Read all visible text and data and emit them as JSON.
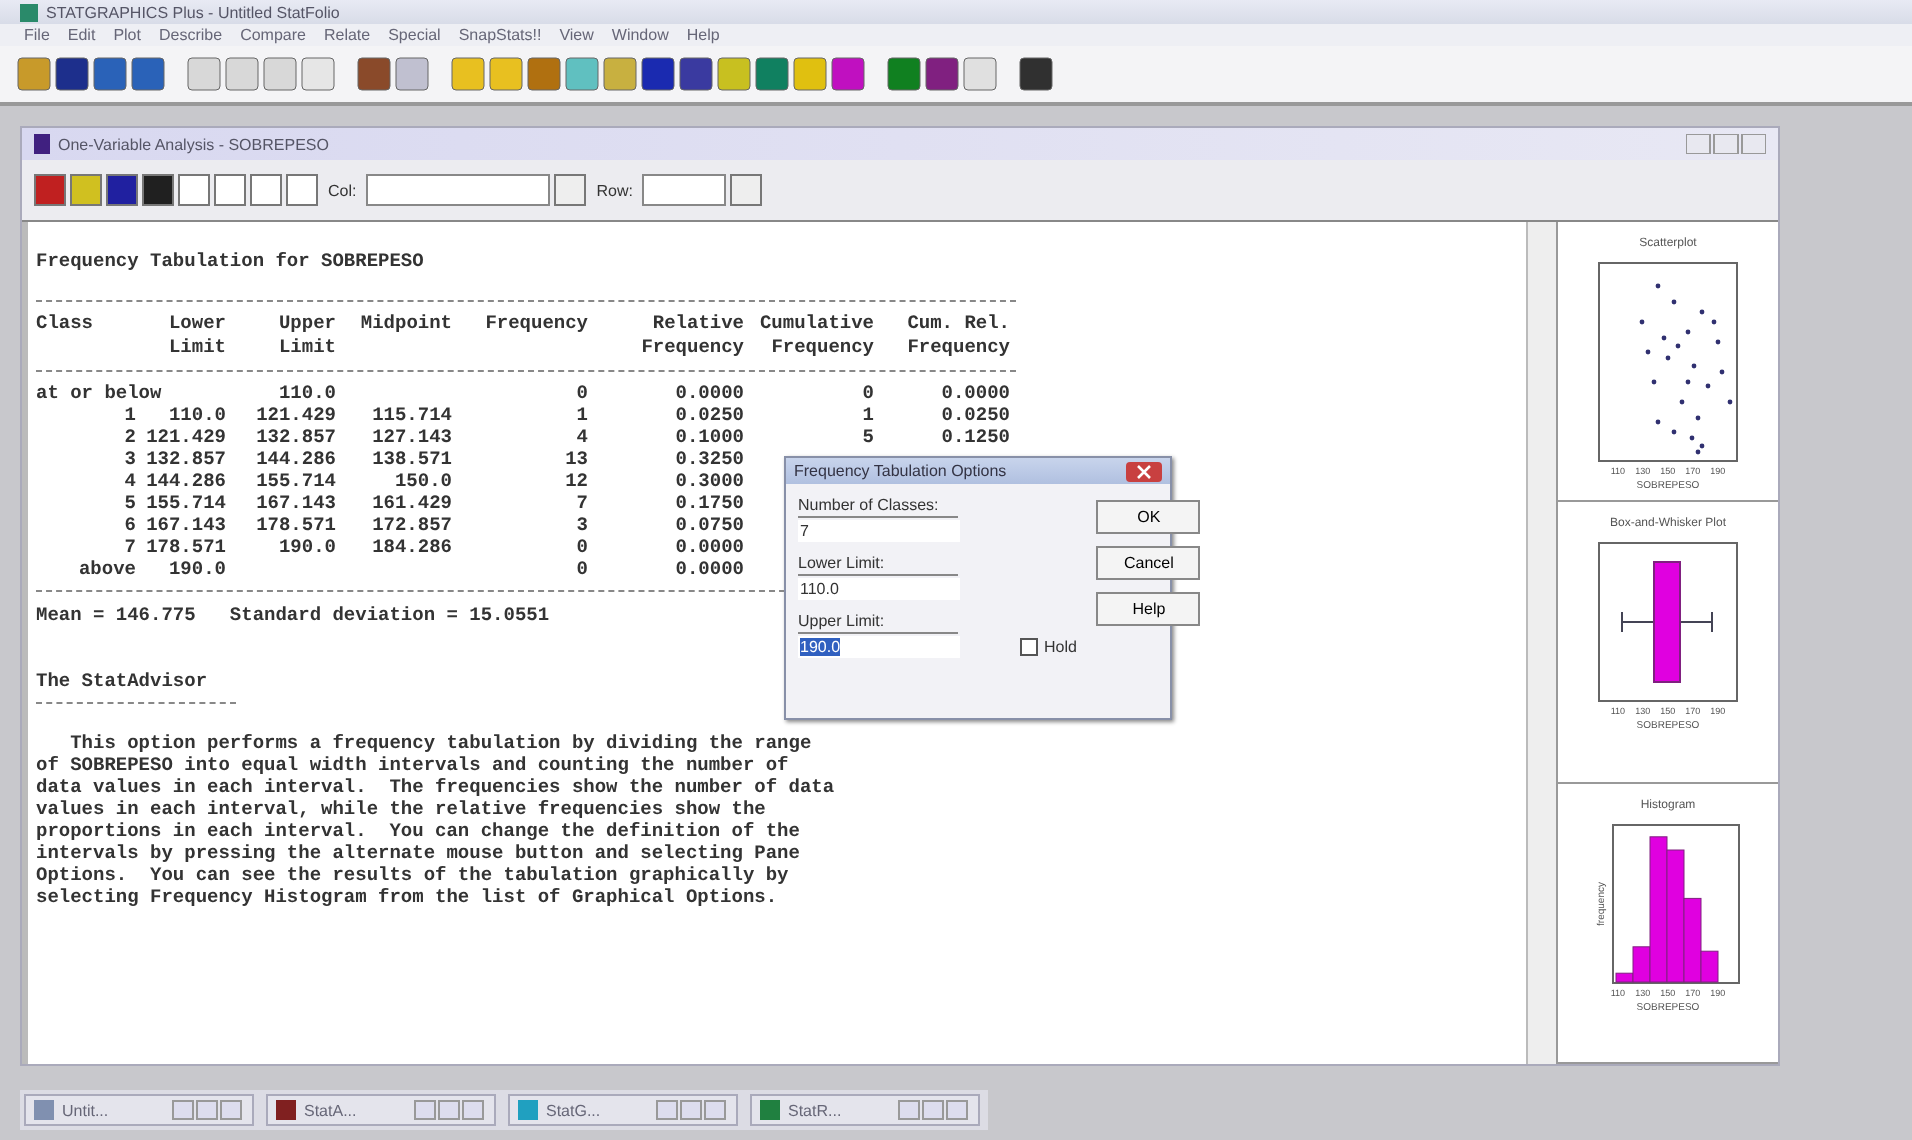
{
  "app": {
    "title": "STATGRAPHICS Plus - Untitled StatFolio",
    "menu": [
      "File",
      "Edit",
      "Plot",
      "Describe",
      "Compare",
      "Relate",
      "Special",
      "SnapStats!!",
      "View",
      "Window",
      "Help"
    ]
  },
  "child": {
    "title": "One-Variable Analysis - SOBREPESO",
    "col_label": "Col:",
    "row_label": "Row:"
  },
  "report": {
    "title": "Frequency Tabulation for SOBREPESO",
    "columns": [
      {
        "bottom": "Class"
      },
      {
        "top": "Lower",
        "bottom": "Limit"
      },
      {
        "top": "Upper",
        "bottom": "Limit"
      },
      {
        "bottom": "Midpoint"
      },
      {
        "bottom": "Frequency"
      },
      {
        "top": "Relative",
        "bottom": "Frequency"
      },
      {
        "top": "Cumulative",
        "bottom": "Frequency"
      },
      {
        "top": "Cum. Rel.",
        "bottom": "Frequency"
      }
    ],
    "rows": [
      [
        "at or below",
        "",
        "110.0",
        "",
        "0",
        "0.0000",
        "0",
        "0.0000"
      ],
      [
        "1",
        "110.0",
        "121.429",
        "115.714",
        "1",
        "0.0250",
        "1",
        "0.0250"
      ],
      [
        "2",
        "121.429",
        "132.857",
        "127.143",
        "4",
        "0.1000",
        "5",
        "0.1250"
      ],
      [
        "3",
        "132.857",
        "144.286",
        "138.571",
        "13",
        "0.3250"
      ],
      [
        "4",
        "144.286",
        "155.714",
        "150.0",
        "12",
        "0.3000"
      ],
      [
        "5",
        "155.714",
        "167.143",
        "161.429",
        "7",
        "0.1750"
      ],
      [
        "6",
        "167.143",
        "178.571",
        "172.857",
        "3",
        "0.0750"
      ],
      [
        "7",
        "178.571",
        "190.0",
        "184.286",
        "0",
        "0.0000"
      ],
      [
        "above",
        "190.0",
        "",
        "",
        "0",
        "0.0000"
      ]
    ],
    "summary": "Mean = 146.775   Standard deviation = 15.0551",
    "advisor_title": "The StatAdvisor",
    "advisor_text": "   This option performs a frequency tabulation by dividing the range\nof SOBREPESO into equal width intervals and counting the number of\ndata values in each interval.  The frequencies show the number of data\nvalues in each interval, while the relative frequencies show the\nproportions in each interval.  You can change the definition of the\nintervals by pressing the alternate mouse button and selecting Pane\nOptions.  You can see the results of the tabulation graphically by\nselecting Frequency Histogram from the list of Graphical Options."
  },
  "panes": [
    {
      "kind": "scatter",
      "title": "Scatterplot",
      "axis_label": "SOBREPESO",
      "ticks": [
        "110",
        "130",
        "150",
        "170",
        "190"
      ]
    },
    {
      "kind": "box",
      "title": "Box-and-Whisker Plot",
      "axis_label": "SOBREPESO",
      "ticks": [
        "110",
        "130",
        "150",
        "170",
        "190"
      ]
    },
    {
      "kind": "histogram",
      "title": "Histogram",
      "ylabel": "frequency",
      "axis_label": "SOBREPESO",
      "ticks": [
        "110",
        "130",
        "150",
        "170",
        "190"
      ]
    }
  ],
  "dialog": {
    "title": "Frequency Tabulation Options",
    "fields": [
      {
        "label": "Number of Classes:",
        "value": "7",
        "selected": false
      },
      {
        "label": "Lower Limit:",
        "value": "110.0",
        "selected": false
      },
      {
        "label": "Upper Limit:",
        "value": "190.0",
        "selected": true
      }
    ],
    "buttons": [
      "OK",
      "Cancel",
      "Help"
    ],
    "hold": {
      "label": "Hold",
      "checked": false
    }
  },
  "taskbar": [
    {
      "title": "Untit..."
    },
    {
      "title": "StatA..."
    },
    {
      "title": "StatG..."
    },
    {
      "title": "StatR..."
    }
  ]
}
